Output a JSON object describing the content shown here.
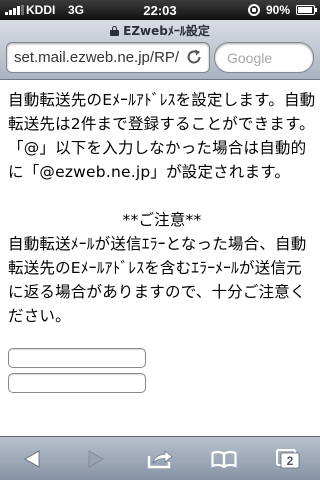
{
  "status_bar": {
    "carrier": "KDDI",
    "network": "3G",
    "time": "22:03",
    "battery_percent": "90%",
    "battery_level": 0.9
  },
  "browser": {
    "page_title": "EZwebﾒｰﾙ設定",
    "url": "set.mail.ezweb.ne.jp/RP/",
    "search_placeholder": "Google",
    "tab_count": "2"
  },
  "content": {
    "paragraph1": "自動転送先のEﾒｰﾙｱﾄﾞﾚｽを設定します。自動転送先は2件まで登録することができます。",
    "paragraph2": "「@」以下を入力しなかった場合は自動的に「@ezweb.ne.jp」が設定されます。",
    "notice_heading": "**ご注意**",
    "paragraph3": "自動転送ﾒｰﾙが送信ｴﾗｰとなった場合、自動転送先のEﾒｰﾙｱﾄﾞﾚｽを含むｴﾗｰﾒｰﾙが送信元に返る場合がありますので、十分ご注意ください。"
  },
  "icons": {
    "back": "back-arrow-icon",
    "forward": "forward-arrow-icon",
    "share": "share-icon",
    "bookmarks": "bookmarks-icon",
    "tabs": "tabs-icon",
    "reload": "reload-icon"
  }
}
